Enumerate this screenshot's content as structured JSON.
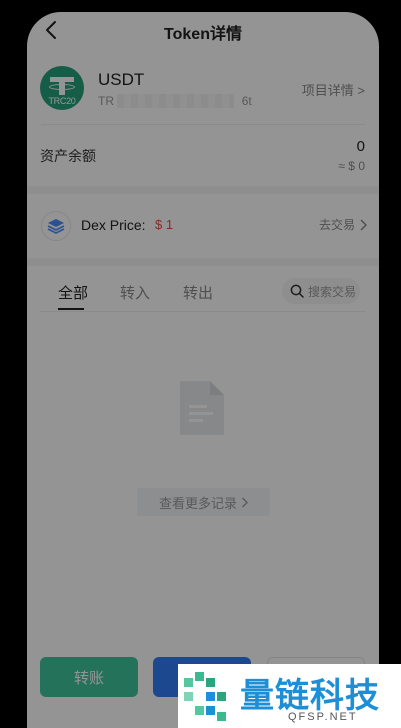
{
  "header": {
    "title": "Token详情"
  },
  "token": {
    "symbol": "USDT",
    "chain_badge": "TRC20",
    "address_prefix": "TR",
    "address_suffix": "6t",
    "project_link": "项目详情 >"
  },
  "balance": {
    "label": "资产余额",
    "amount": "0",
    "fiat": "≈ $ 0"
  },
  "dex": {
    "label": "Dex Price:",
    "price": "$ 1",
    "trade_link": "去交易"
  },
  "tabs": [
    {
      "label": "全部",
      "active": true
    },
    {
      "label": "转入",
      "active": false
    },
    {
      "label": "转出",
      "active": false
    }
  ],
  "search": {
    "placeholder": "搜索交易"
  },
  "empty": {
    "more_records": "查看更多记录"
  },
  "bottom": {
    "transfer_label": "转账"
  },
  "watermark": {
    "name": "量链科技",
    "domain": "QFSP.NET"
  },
  "colors": {
    "usdt_green": "#26a17b",
    "transfer_green": "#41c49b",
    "receive_blue": "#2f7cf6",
    "price_red": "#e0504a",
    "watermark_blue": "#1d8fd6"
  }
}
